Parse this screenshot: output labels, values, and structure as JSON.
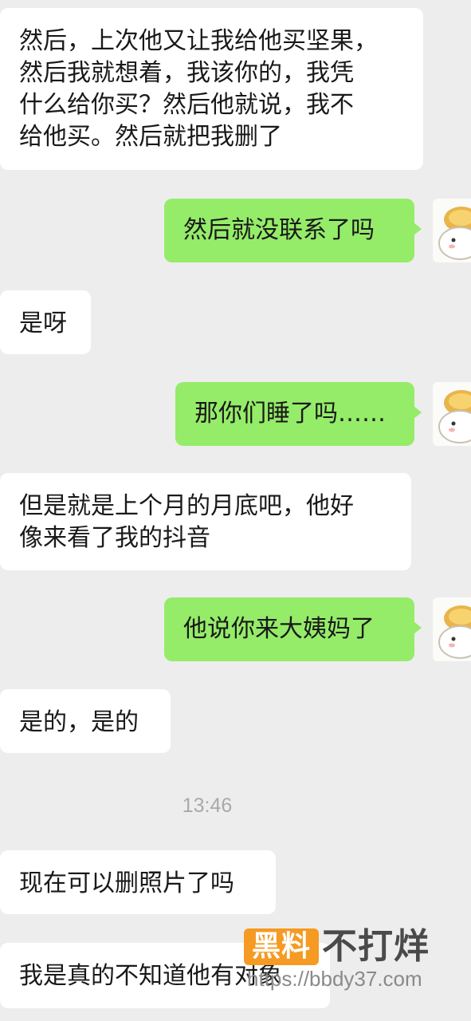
{
  "messages": [
    {
      "side": "in",
      "text": "然后，上次他又让我给他买坚果，\n然后我就想着，我该你的，我凭\n什么给你买？然后他就说，我不\n给他买。然后就把我删了"
    },
    {
      "side": "out",
      "text": "然后就没联系了吗"
    },
    {
      "side": "in",
      "text": "是呀"
    },
    {
      "side": "out",
      "text": "那你们睡了吗……"
    },
    {
      "side": "in",
      "text": "但是就是上个月的月底吧，他好\n像来看了我的抖音"
    },
    {
      "side": "out",
      "text": "他说你来大姨妈了"
    },
    {
      "side": "in",
      "text": "是的，是的"
    },
    {
      "side": "in",
      "text": "现在可以删照片了吗"
    },
    {
      "side": "in",
      "text": "我是真的不知道他有对象"
    }
  ],
  "timestamp": "13:46",
  "avatar_icon": "cartoon-character-avatar-icon",
  "watermark": {
    "logo_text": "黑料",
    "brand": "不打烊",
    "url": "https://bbdy37.com",
    "logo_color": "#f59a23"
  },
  "colors": {
    "background": "#ededed",
    "incoming_bubble": "#ffffff",
    "outgoing_bubble": "#95ec69",
    "text": "#191919",
    "timestamp": "#a9a9a9"
  }
}
